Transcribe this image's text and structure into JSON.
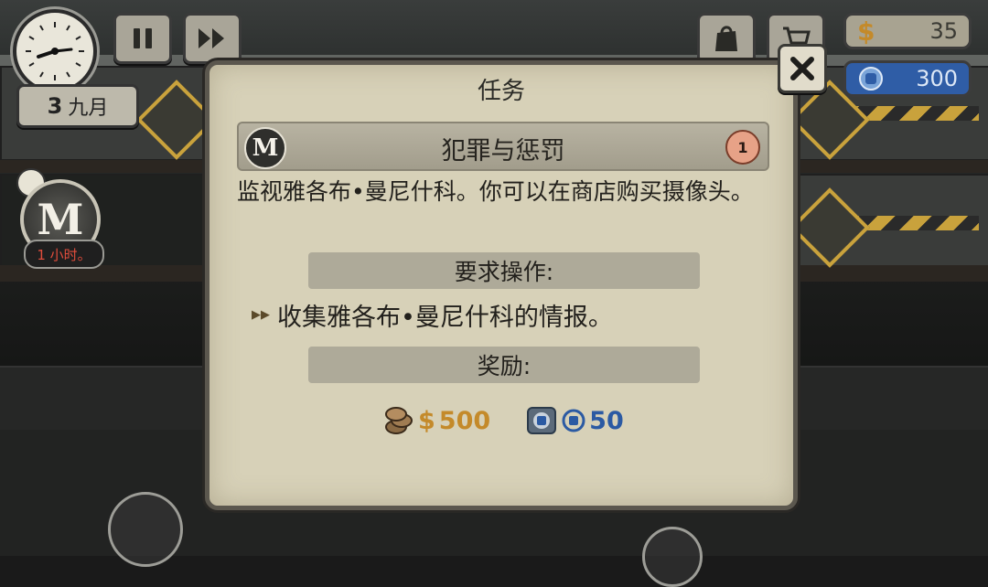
{
  "hud": {
    "date_day": "3",
    "date_month": "九月",
    "money": "35",
    "reputation": "300"
  },
  "side": {
    "timer": "1 小时。"
  },
  "dialog": {
    "title": "任务",
    "case_title": "犯罪与惩罚",
    "case_count": "1",
    "description": "监视雅各布•曼尼什科。你可以在商店购买摄像头。",
    "requirements_label": "要求操作:",
    "task": "收集雅各布•曼尼什科的情报。",
    "rewards_label": "奖励:",
    "reward_money": "500",
    "reward_reputation": "50"
  },
  "colors": {
    "dialog_bg": "#d7d1b8",
    "money_gold": "#c48a2a",
    "reputation_blue": "#2b5aa3",
    "timer_red": "#e04d3c"
  },
  "icons": [
    "clock-icon",
    "pause-icon",
    "fast-forward-icon",
    "bag-icon",
    "cart-icon",
    "dollar-icon",
    "reputation-icon",
    "close-icon",
    "coins-icon",
    "reputation-badge-icon"
  ]
}
